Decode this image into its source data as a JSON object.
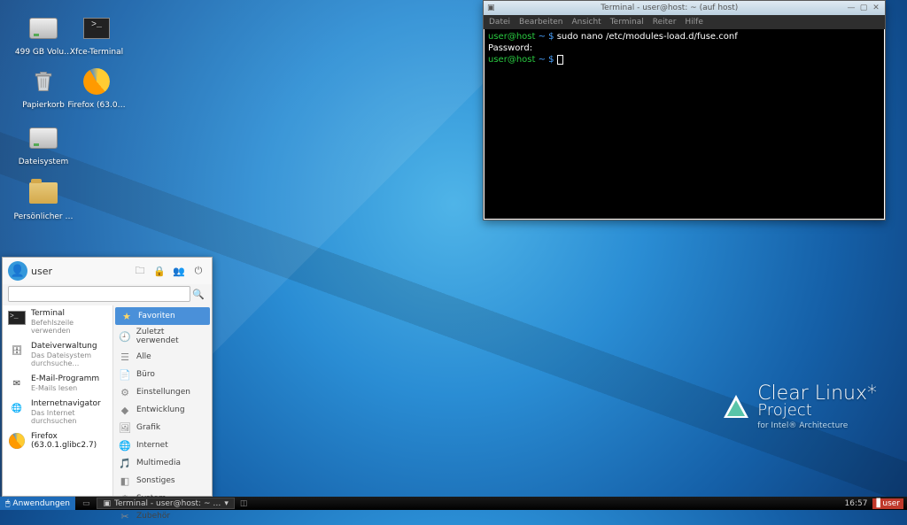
{
  "desktop": {
    "icons": [
      {
        "label": "499 GB Volu…"
      },
      {
        "label": "Xfce-Terminal"
      },
      {
        "label": "Papierkorb"
      },
      {
        "label": "Firefox (63.0…"
      },
      {
        "label": "Dateisystem"
      },
      {
        "label": "Persönlicher …"
      }
    ]
  },
  "terminal": {
    "title": "Terminal - user@host: ~ (auf host)",
    "menu": [
      "Datei",
      "Bearbeiten",
      "Ansicht",
      "Terminal",
      "Reiter",
      "Hilfe"
    ],
    "line1_user": "user",
    "line1_at": "@",
    "line1_host": "host",
    "line1_path": " ~ $ ",
    "line1_cmd": "sudo nano /etc/modules-load.d/fuse.conf",
    "line2": "Password:",
    "line3_user": "user",
    "line3_at": "@",
    "line3_host": "host",
    "line3_path": " ~ $ "
  },
  "appmenu": {
    "user": "user",
    "search_placeholder": "",
    "topbuttons": [
      "folder",
      "lock",
      "user",
      "power"
    ],
    "favorites": [
      {
        "title": "Terminal",
        "sub": "Befehlszeile verwenden",
        "icon": "term"
      },
      {
        "title": "Dateiverwaltung",
        "sub": "Das Dateisystem durchsuche…",
        "icon": "files"
      },
      {
        "title": "E-Mail-Programm",
        "sub": "E-Mails lesen",
        "icon": "mail"
      },
      {
        "title": "Internetnavigator",
        "sub": "Das Internet durchsuchen",
        "icon": "globe"
      },
      {
        "title": "Firefox (63.0.1.glibc2.7)",
        "sub": "",
        "icon": "fx"
      }
    ],
    "categories": [
      {
        "label": "Favoriten",
        "sel": true,
        "glyph": "★"
      },
      {
        "label": "Zuletzt verwendet",
        "glyph": "🕘"
      },
      {
        "label": "Alle",
        "glyph": "☰"
      },
      {
        "label": "Büro",
        "glyph": "📄"
      },
      {
        "label": "Einstellungen",
        "glyph": "⚙"
      },
      {
        "label": "Entwicklung",
        "glyph": "◆"
      },
      {
        "label": "Grafik",
        "glyph": "🖼"
      },
      {
        "label": "Internet",
        "glyph": "🌐"
      },
      {
        "label": "Multimedia",
        "glyph": "🎵"
      },
      {
        "label": "Sonstiges",
        "glyph": "◧"
      },
      {
        "label": "System",
        "glyph": "⚙"
      },
      {
        "label": "Zubehör",
        "glyph": "✂"
      }
    ]
  },
  "brand": {
    "l1": "Clear Linux*",
    "l2": "Project",
    "l3": "for Intel® Architecture"
  },
  "taskbar": {
    "app_button": "Anwendungen",
    "task": "Terminal - user@host: ~ …",
    "clock": "16:57",
    "user": "user"
  }
}
